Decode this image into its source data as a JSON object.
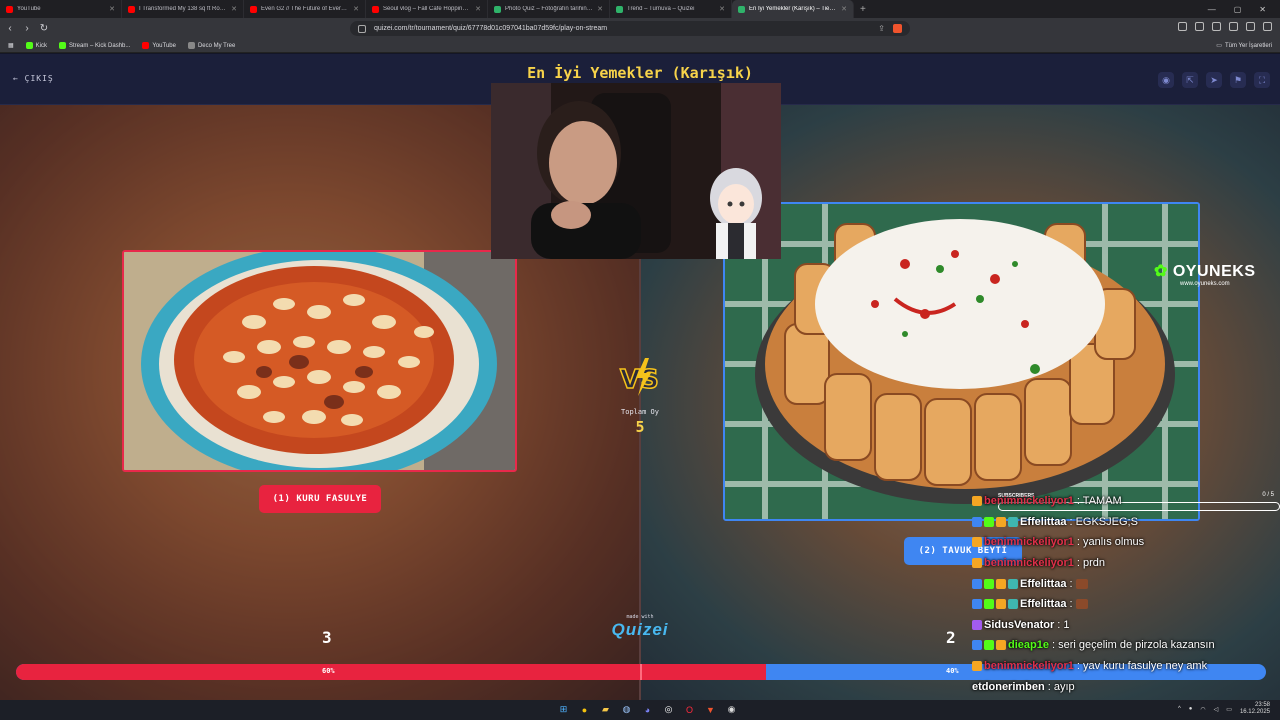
{
  "browser": {
    "tabs": [
      {
        "title": "YouTube",
        "favicon_color": "#ff0000",
        "active": false
      },
      {
        "title": "I Transformed My 138 sq ft Room Int",
        "favicon_color": "#ff0000",
        "active": false
      },
      {
        "title": "Even G2 // The Future of Everyday Sr",
        "favicon_color": "#ff0000",
        "active": false
      },
      {
        "title": "Seoul vlog – Fall Cafe Hopping, Top",
        "favicon_color": "#ff0000",
        "active": false
      },
      {
        "title": "Photo Quiz – Fotoğrafın tarihini ve ko",
        "favicon_color": "#2fb36a",
        "active": false
      },
      {
        "title": "Trend – Turnuva – Quizei",
        "favicon_color": "#2fb36a",
        "active": false
      },
      {
        "title": "En İyi Yemekler (Karışık) – Tier Li",
        "favicon_color": "#2fb36a",
        "active": true
      }
    ],
    "url": "quizei.com/tr/tournament/quiz/67778d01c097041ba07d59fc/play-on-stream",
    "bookmarks": [
      {
        "label": "Kick",
        "color": "#53fc18"
      },
      {
        "label": "Stream – Kick Dashb...",
        "color": "#53fc18"
      },
      {
        "label": "YouTube",
        "color": "#ff0000"
      },
      {
        "label": "Deco My Tree",
        "color": "#888888"
      }
    ],
    "all_bookmarks": "Tüm Yer İşaretleri"
  },
  "page": {
    "exit_label": "ÇIKIŞ",
    "title": "En İyi Yemekler (Karışık)",
    "total_label": "Toplam Oy",
    "total_votes": "5",
    "made_with": "made with",
    "brand": "Quizei"
  },
  "options": {
    "left": {
      "label": "(1) KURU FASULYE",
      "votes": "3",
      "percent_label": "60%",
      "percent": 60,
      "color": "#e8233f"
    },
    "right": {
      "label": "(2) TAVUK BEYTİ",
      "votes": "2",
      "percent_label": "40%",
      "percent": 40,
      "color": "#3f86f2"
    }
  },
  "overlay": {
    "brand_name": "OYUNEKS",
    "brand_url": "www.oyuneks.com",
    "subscribers_label": "SUBSCRIBERS",
    "subscribers_count": "0 / 5"
  },
  "chat": [
    {
      "user": "benimnickeliyor1",
      "user_color": "#e0304a",
      "message": ": TAMAM",
      "badges": [
        "#f5a623"
      ]
    },
    {
      "user": "Effelittaa",
      "user_color": "#ffffff",
      "message": ": EGKSJEG;S",
      "badges": [
        "#3f86f2",
        "#53fc18",
        "#f5a623",
        "#3fb6b0"
      ]
    },
    {
      "user": "benimnickeliyor1",
      "user_color": "#e0304a",
      "message": ": yanlıs olmus",
      "badges": [
        "#f5a623"
      ]
    },
    {
      "user": "benimnickeliyor1",
      "user_color": "#e0304a",
      "message": ": prdn",
      "badges": [
        "#f5a623"
      ]
    },
    {
      "user": "Effelittaa",
      "user_color": "#ffffff",
      "message": ":",
      "badges": [
        "#3f86f2",
        "#53fc18",
        "#f5a623",
        "#3fb6b0"
      ],
      "emote": true
    },
    {
      "user": "Effelittaa",
      "user_color": "#ffffff",
      "message": ":",
      "badges": [
        "#3f86f2",
        "#53fc18",
        "#f5a623",
        "#3fb6b0"
      ],
      "emote": true
    },
    {
      "user": "SidusVenator",
      "user_color": "#ffffff",
      "message": ": 1",
      "badges": [
        "#a35cf0"
      ]
    },
    {
      "user": "dieap1e",
      "user_color": "#53fc18",
      "message": ": seri geçelim de pirzola kazansın",
      "badges": [
        "#3f86f2",
        "#53fc18",
        "#f5a623"
      ]
    },
    {
      "user": "benimnickeliyor1",
      "user_color": "#e0304a",
      "message": ": yav kuru fasulye ney amk",
      "badges": [
        "#f5a623"
      ]
    },
    {
      "user": "etdonerimben",
      "user_color": "#ffffff",
      "message": ": ayıp",
      "badges": []
    }
  ],
  "taskbar": {
    "time": "23:58",
    "date": "16.12.2025"
  },
  "colors": {
    "accent_red": "#e8233f",
    "accent_blue": "#3f86f2",
    "title_yellow": "#f7d34a"
  }
}
